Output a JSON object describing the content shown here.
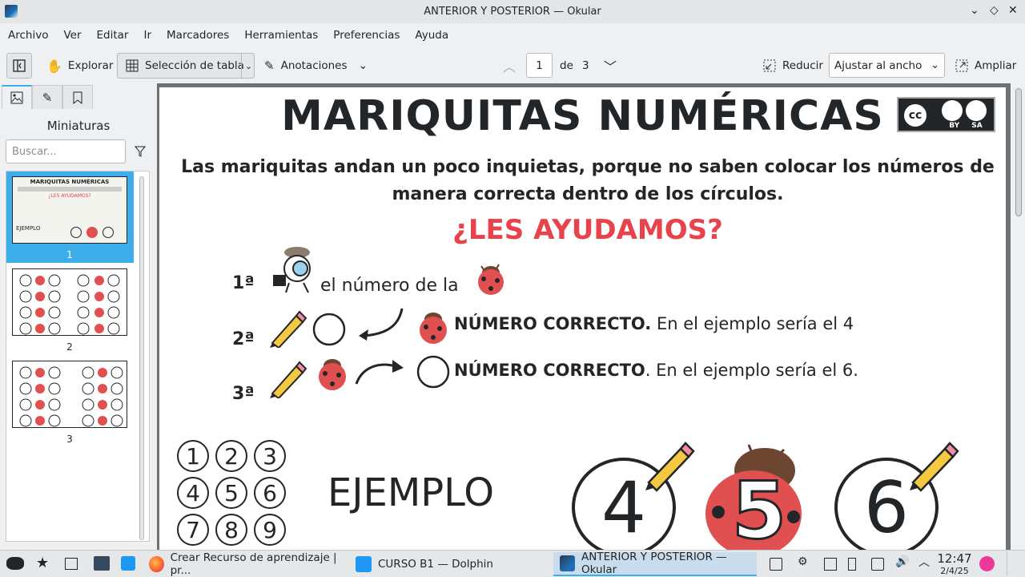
{
  "window": {
    "title": "ANTERIOR Y POSTERIOR — Okular"
  },
  "menu": [
    "Archivo",
    "Ver",
    "Editar",
    "Ir",
    "Marcadores",
    "Herramientas",
    "Preferencias",
    "Ayuda"
  ],
  "toolbar": {
    "browse_label": "Explorar",
    "table_select_label": "Selección de tabla",
    "annotations_label": "Anotaciones",
    "page_current": "1",
    "page_of_label": "de",
    "page_total": "3",
    "zoom_out_label": "Reducir",
    "zoom_mode": "Ajustar al ancho",
    "zoom_in_label": "Ampliar"
  },
  "sidebar": {
    "title": "Miniaturas",
    "search_placeholder": "Buscar...",
    "thumbnails": [
      {
        "label": "1",
        "selected": true
      },
      {
        "label": "2",
        "selected": false
      },
      {
        "label": "3",
        "selected": false
      }
    ]
  },
  "document": {
    "title": "MARIQUITAS NUMÉRICAS",
    "license_badge": "BY SA",
    "license_cc": "cc",
    "intro_line1": "Las mariquitas andan un poco inquietas, porque no saben colocar los números de",
    "intro_line2": "manera correcta dentro de los círculos.",
    "question": "¿LES AYUDAMOS?",
    "steps": [
      {
        "num": "1ª",
        "text": "el número de la"
      },
      {
        "num": "2ª",
        "bold": "NÚMERO CORRECTO.",
        "text": " En el ejemplo sería el 4"
      },
      {
        "num": "3ª",
        "bold": "NÚMERO CORRECTO",
        "text": ". En el ejemplo sería el 6."
      }
    ],
    "grid_numbers": [
      "1",
      "2",
      "3",
      "4",
      "5",
      "6",
      "7",
      "8",
      "9"
    ],
    "example_label": "EJEMPLO",
    "example_numbers": [
      "4",
      "5",
      "6"
    ]
  },
  "taskbar": {
    "tasks": [
      {
        "label": "Crear Recurso de aprendizaje | pr...",
        "icon": "firefox-icon"
      },
      {
        "label": "CURSO B1 — Dolphin",
        "icon": "folder-icon"
      },
      {
        "label": "ANTERIOR Y POSTERIOR  — Okular",
        "icon": "okular-icon"
      }
    ],
    "clock_time": "12:47",
    "clock_date": "2/4/25"
  },
  "colors": {
    "accent": "#3daee9",
    "question_red": "#e8434a",
    "ladybug_red": "#e05050"
  }
}
